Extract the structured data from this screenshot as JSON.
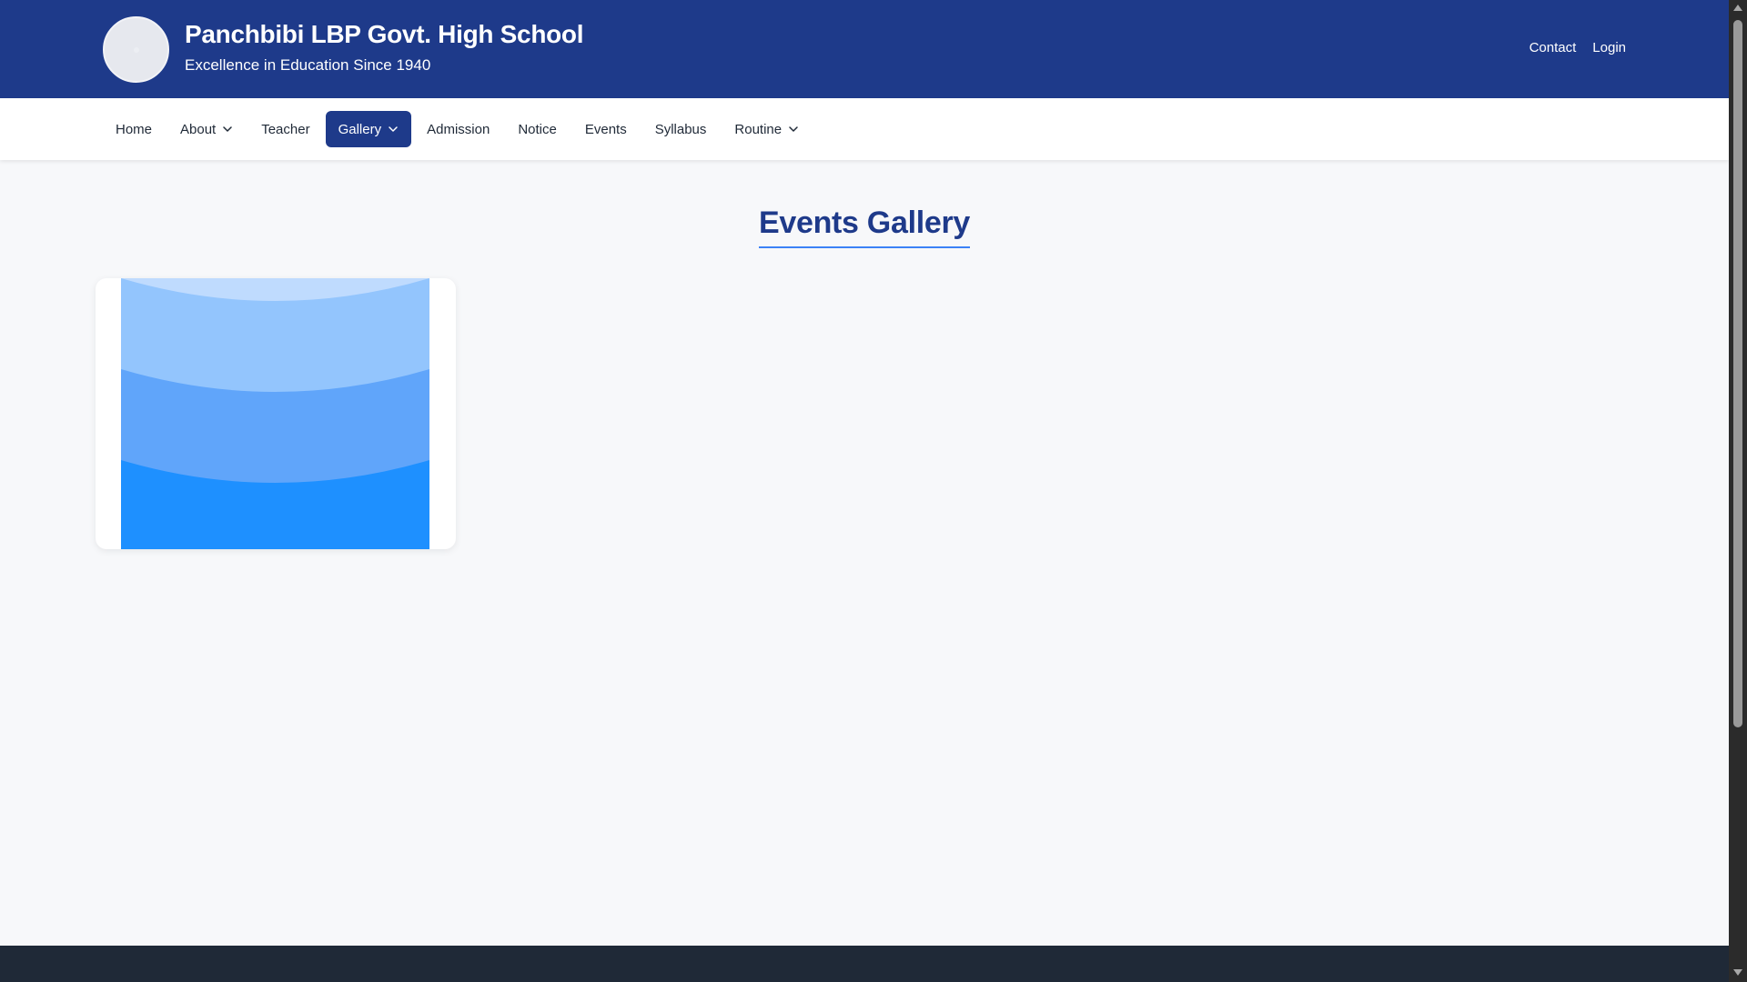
{
  "header": {
    "school_name": "Panchbibi LBP Govt. High School",
    "tagline": "Excellence in Education Since 1940",
    "links": {
      "contact": "Contact",
      "login": "Login"
    }
  },
  "nav": {
    "items": [
      {
        "label": "Home",
        "dropdown": false,
        "active": false
      },
      {
        "label": "About",
        "dropdown": true,
        "active": false
      },
      {
        "label": "Teacher",
        "dropdown": false,
        "active": false
      },
      {
        "label": "Gallery",
        "dropdown": true,
        "active": true
      },
      {
        "label": "Admission",
        "dropdown": false,
        "active": false
      },
      {
        "label": "Notice",
        "dropdown": false,
        "active": false
      },
      {
        "label": "Events",
        "dropdown": false,
        "active": false
      },
      {
        "label": "Syllabus",
        "dropdown": false,
        "active": false
      },
      {
        "label": "Routine",
        "dropdown": true,
        "active": false
      }
    ]
  },
  "main": {
    "title": "Events Gallery"
  },
  "colors": {
    "primary": "#1e3a8a",
    "accent": "#3b82f6",
    "footer": "#1f2937",
    "image_light": "#bfdbfe",
    "image_mid1": "#93c5fd",
    "image_mid2": "#60a5fa",
    "image_dark": "#1e90ff"
  }
}
